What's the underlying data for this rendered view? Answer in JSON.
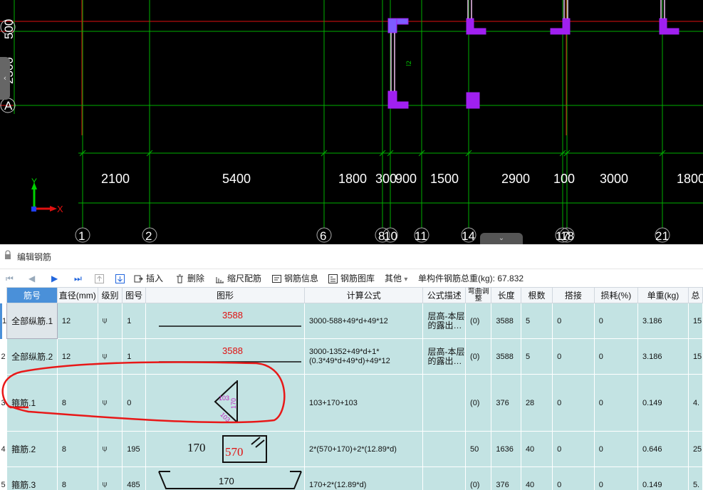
{
  "cad": {
    "axis_labels_left": [
      "500",
      "2300",
      "A"
    ],
    "axis_numbers": [
      "1",
      "2",
      "6",
      "8",
      "10",
      "11",
      "14",
      "17",
      "18",
      "21"
    ],
    "dimensions": [
      "2100",
      "5400",
      "1800",
      "300",
      "900",
      "1500",
      "2900",
      "100",
      "3000",
      "1800"
    ],
    "coord_x_label": "X",
    "coord_y_label": "Y",
    "collapse_tab_glyph": "⌄",
    "left_collapse_glyph": "‹",
    "colors": {
      "grid_green": "#00b000",
      "axis_red": "#e01010",
      "rebar_purple": "#a020f0",
      "background": "#000000"
    }
  },
  "panel": {
    "title": "编辑钢筋",
    "lock_icon": "lock-icon"
  },
  "toolbar": {
    "nav_first": "⏮",
    "nav_prev": "◀",
    "nav_next": "▶",
    "nav_last": "⏭",
    "insert": "插入",
    "delete": "删除",
    "scale_rebar": "缩尺配筋",
    "rebar_info": "钢筋信息",
    "rebar_library": "钢筋图库",
    "other": "其他",
    "other_arrow": "▾",
    "total_weight_label": "单构件钢筋总重(kg): 67.832"
  },
  "table": {
    "headers": [
      "筋号",
      "直径(mm)",
      "级别",
      "图号",
      "图形",
      "计算公式",
      "公式描述",
      "弯曲调整",
      "长度",
      "根数",
      "搭接",
      "损耗(%)",
      "单重(kg)",
      "总"
    ],
    "rows": [
      {
        "num": "1",
        "name": "全部纵筋.1",
        "dia": "12",
        "grade": "⍦",
        "fig": "1",
        "fig_label": "3588",
        "formula": "3000-588+49*d+49*12",
        "desc": "层高-本层的露出…",
        "bend": "(0)",
        "length": "3588",
        "count": "5",
        "lap": "0",
        "loss": "0",
        "unit": "3.186",
        "total": "15"
      },
      {
        "num": "2",
        "name": "全部纵筋.2",
        "dia": "12",
        "grade": "⍦",
        "fig": "1",
        "fig_label": "3588",
        "formula": "3000-1352+49*d+1*(0.3*49*d+49*d)+49*12",
        "desc": "层高-本层的露出…",
        "bend": "(0)",
        "length": "3588",
        "count": "5",
        "lap": "0",
        "loss": "0",
        "unit": "3.186",
        "total": "15"
      },
      {
        "num": "3",
        "name": "箍筋.1",
        "dia": "8",
        "grade": "⍦",
        "fig": "0",
        "fig_label": "103",
        "fig_label2": "170",
        "fig_label3": "103",
        "formula": "103+170+103",
        "desc": "",
        "bend": "(0)",
        "length": "376",
        "count": "28",
        "lap": "0",
        "loss": "0",
        "unit": "0.149",
        "total": "4."
      },
      {
        "num": "4",
        "name": "箍筋.2",
        "dia": "8",
        "grade": "⍦",
        "fig": "195",
        "fig_label": "170",
        "fig_label2": "570",
        "formula": "2*(570+170)+2*(12.89*d)",
        "desc": "",
        "bend": "50",
        "length": "1636",
        "count": "40",
        "lap": "0",
        "loss": "0",
        "unit": "0.646",
        "total": "25"
      },
      {
        "num": "5",
        "name": "箍筋.3",
        "dia": "8",
        "grade": "⍦",
        "fig": "485",
        "fig_label": "170",
        "formula": "170+2*(12.89*d)",
        "desc": "",
        "bend": "(0)",
        "length": "376",
        "count": "40",
        "lap": "0",
        "loss": "0",
        "unit": "0.149",
        "total": "5."
      }
    ]
  }
}
